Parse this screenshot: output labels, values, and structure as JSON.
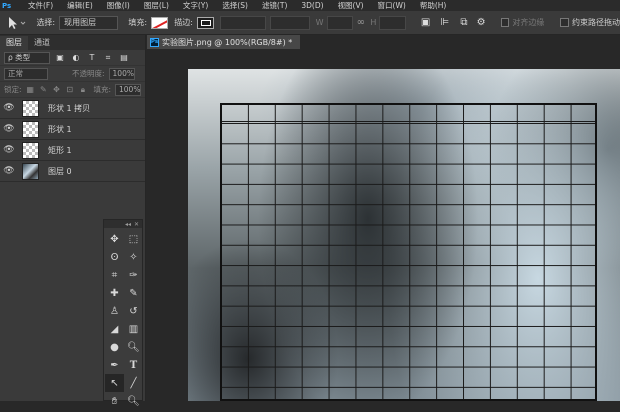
{
  "menubar": {
    "app_icon": "Ps",
    "items": [
      "文件(F)",
      "编辑(E)",
      "图像(I)",
      "图层(L)",
      "文字(Y)",
      "选择(S)",
      "滤镜(T)",
      "3D(D)",
      "视图(V)",
      "窗口(W)",
      "帮助(H)"
    ]
  },
  "options": {
    "select_label": "选择:",
    "select_value": "现用图层",
    "fill_label": "填充:",
    "stroke_label": "描边:",
    "align_edges_label": "对齐边缘",
    "constrain_label": "约束路径拖动",
    "fill_color": "#d22222",
    "stroke_color": "#ffffff"
  },
  "panel": {
    "tabs": [
      "图层",
      "通道"
    ],
    "filter_label": "ρ 类型",
    "blend_mode": "正常",
    "opacity_label": "不透明度:",
    "opacity_value": "100%",
    "lock_label": "锁定:",
    "fill_label": "填充:",
    "fill_value": "100%",
    "layers": [
      {
        "name": "形状 1 拷贝",
        "icon": "shape-layer-thumbnail"
      },
      {
        "name": "形状 1",
        "icon": "shape-layer-thumbnail"
      },
      {
        "name": "矩形 1",
        "icon": "shape-layer-thumbnail"
      },
      {
        "name": "图层 0",
        "icon": "image-layer-thumbnail"
      }
    ]
  },
  "document": {
    "tab_icon": "Ps",
    "tab_title": "实验图片.png @ 100%(RGB/8#) *"
  },
  "grid": {
    "rows": 14,
    "cols": 14,
    "line_color": "#1a1a1a"
  }
}
